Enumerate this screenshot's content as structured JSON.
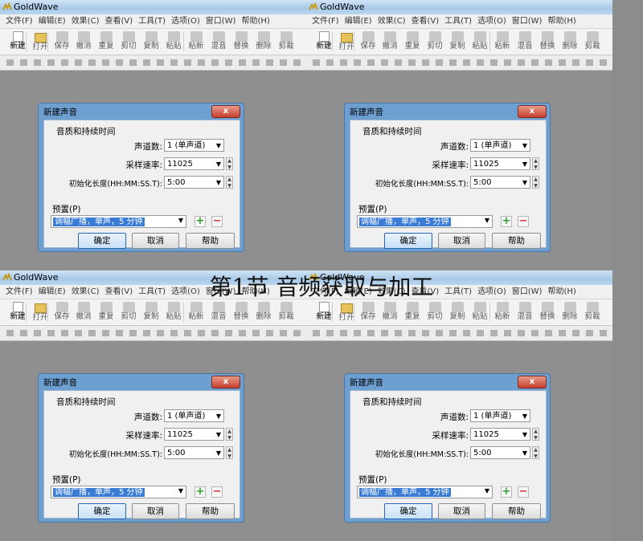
{
  "caption": "第1节 音频获取与加工",
  "app": {
    "title": "GoldWave"
  },
  "menu": [
    "文件(F)",
    "编辑(E)",
    "效果(C)",
    "查看(V)",
    "工具(T)",
    "选项(O)",
    "窗口(W)",
    "帮助(H)"
  ],
  "toolbar": [
    "新建",
    "打开",
    "保存",
    "撤消",
    "重复",
    "剪切",
    "复制",
    "粘贴",
    "粘新",
    "混音",
    "替换",
    "删除",
    "剪裁"
  ],
  "dialog": {
    "title": "新建声音",
    "close": "x",
    "group_title": "音质和持续时间",
    "channels_label": "声道数:",
    "channels_value": "1 (单声道)",
    "rate_label": "采样速率:",
    "rate_value": "11025",
    "length_label": "初始化长度(HH:MM:SS.T):",
    "length_value": "5:00",
    "preset_label": "预置(P)",
    "preset_value": "调幅广播，单声，5 分钟",
    "ok": "确定",
    "cancel": "取消",
    "help": "帮助"
  },
  "colors": {
    "accent": "#3a7bd5",
    "dialog_frame": "#6e9fd1",
    "background": "#8c8c8c"
  }
}
